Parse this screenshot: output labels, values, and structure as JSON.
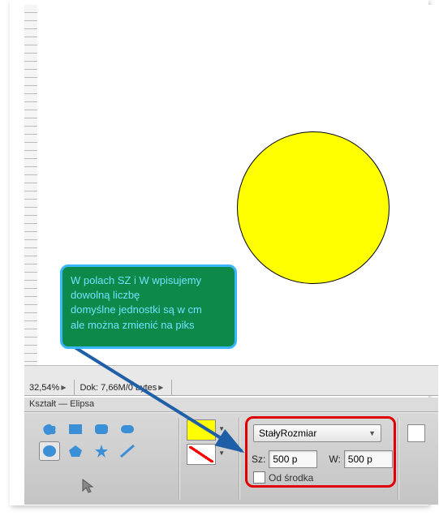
{
  "status": {
    "zoom": "32,54%",
    "doc": "Dok: 7,66M/0 bytes"
  },
  "tool_label": "Kształt — Elipsa",
  "callout": {
    "line1": "W polach SZ i W wpisujemy",
    "line2": "dowolną liczbę",
    "line3": "domyślne jednostki są w cm",
    "line4": "ale można zmienić na piks"
  },
  "options": {
    "dropdown": "StałyRozmiar",
    "sz_label": "Sz:",
    "sz_value": "500 p",
    "w_label": "W:",
    "w_value": "500 p",
    "from_center_label": "Od środka"
  }
}
